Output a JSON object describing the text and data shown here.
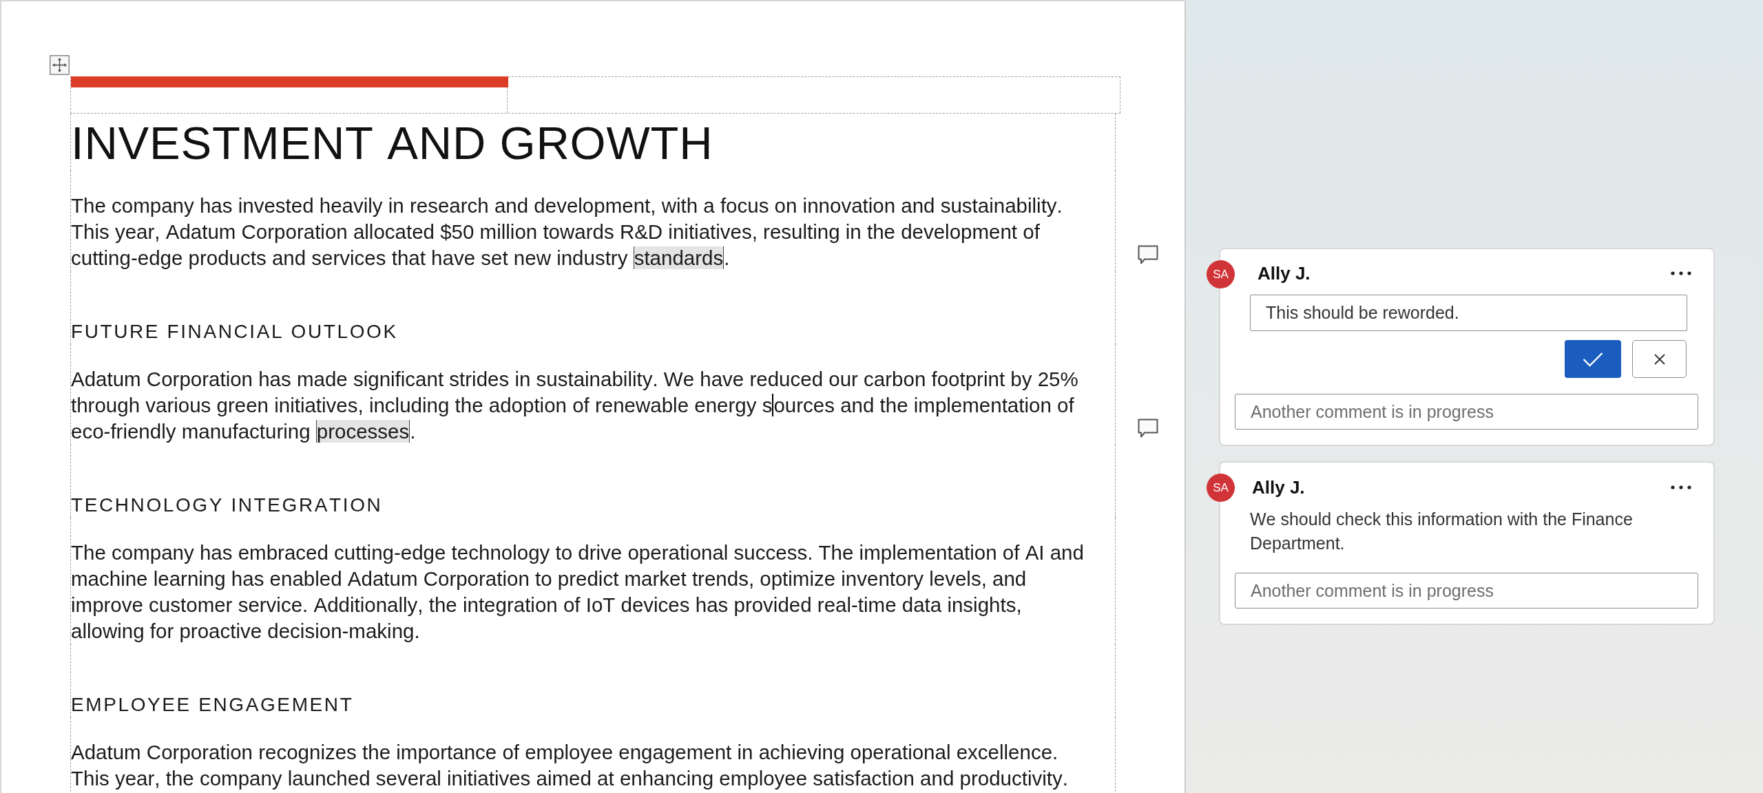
{
  "document": {
    "title": "INVESTMENT AND GROWTH",
    "blocks": [
      {
        "kind": "paragraph",
        "has_comment": true,
        "segments": [
          {
            "kind": "plain",
            "text": "The company has invested heavily in research and development, with a focus on innovation and sustainability. This year, Adatum Corporation allocated $50 million towards R&D initiatives, resulting in the development of cutting-edge products and services that have set new industry "
          },
          {
            "kind": "comment_anchor",
            "text": "standards"
          },
          {
            "kind": "plain",
            "text": "."
          }
        ]
      },
      {
        "kind": "heading",
        "has_comment": false,
        "text": "FUTURE FINANCIAL OUTLOOK"
      },
      {
        "kind": "paragraph",
        "has_comment": true,
        "segments": [
          {
            "kind": "plain",
            "text": "Adatum Corporation has made significant strides in sustainability. We have reduced our carbon footprint by 25% through various green initiatives, including the adoption of renewable energy s"
          },
          {
            "kind": "cursor_before",
            "text": "ources and the implementation of eco-friendly manufacturing "
          },
          {
            "kind": "comment_anchor",
            "text": "processes"
          },
          {
            "kind": "plain",
            "text": "."
          }
        ]
      },
      {
        "kind": "heading",
        "has_comment": false,
        "text": "TECHNOLOGY INTEGRATION"
      },
      {
        "kind": "paragraph",
        "has_comment": false,
        "segments": [
          {
            "kind": "plain",
            "text": "The company has embraced cutting-edge technology to drive operational success. The implementation of AI and machine learning has enabled Adatum Corporation to predict market trends, optimize inventory levels, and improve customer service. Additionally, the integration of IoT devices has provided real-time data insights, allowing for proactive decision-making."
          }
        ]
      },
      {
        "kind": "heading",
        "has_comment": false,
        "text": "EMPLOYEE ENGAGEMENT"
      },
      {
        "kind": "paragraph",
        "has_comment": false,
        "segments": [
          {
            "kind": "plain",
            "text": "Adatum Corporation recognizes the importance of employee engagement in achieving operational excellence. This year, the company launched several initiatives aimed at enhancing employee satisfaction and productivity."
          }
        ]
      }
    ]
  },
  "comments": [
    {
      "kind": "editing",
      "initials": "SA",
      "author": "Ally J.",
      "draft": {
        "value": "This should be reworded."
      },
      "reply_field": {
        "placeholder": "Another comment is in progress"
      }
    },
    {
      "kind": "posted",
      "initials": "SA",
      "author": "Ally J.",
      "text": "We should check this information with the Finance Department.",
      "reply_field": {
        "placeholder": "Another comment is in progress"
      }
    }
  ]
}
